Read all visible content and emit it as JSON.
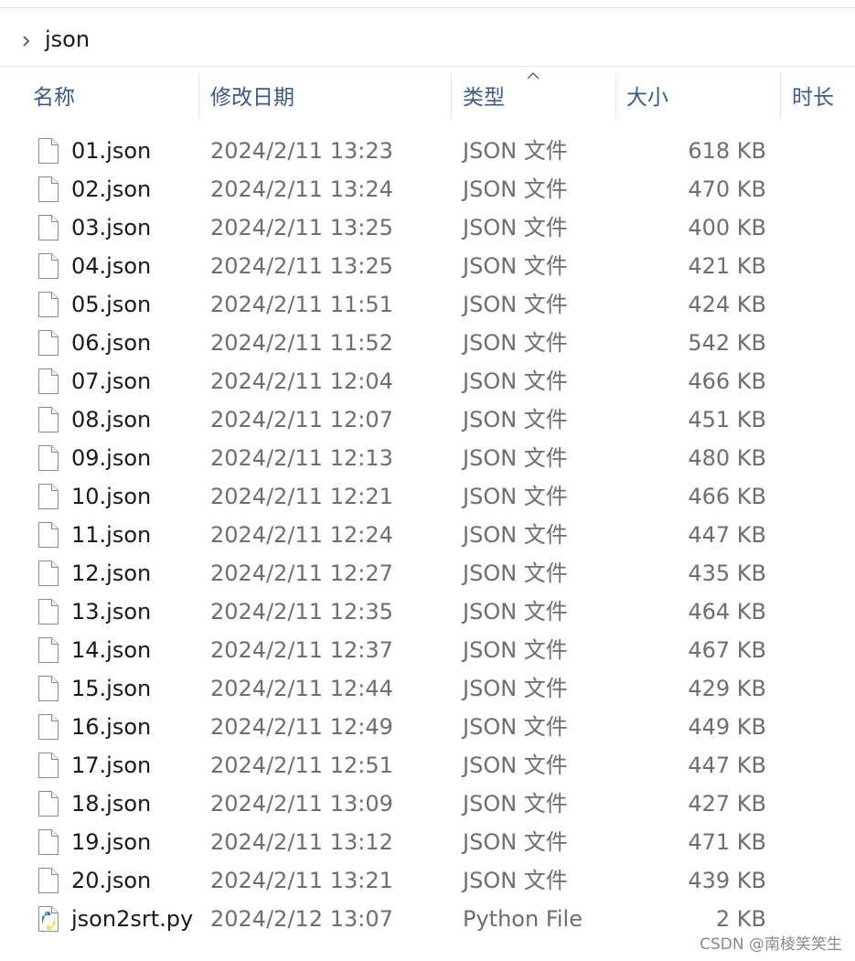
{
  "breadcrumb": {
    "label": "json"
  },
  "columns": {
    "name": "名称",
    "modified": "修改日期",
    "type": "类型",
    "size": "大小",
    "duration": "时长"
  },
  "sort": {
    "column": "type",
    "direction": "ascending"
  },
  "files": [
    {
      "name": "01.json",
      "modified": "2024/2/11 13:23",
      "type": "JSON 文件",
      "size": "618 KB",
      "icon": "json-file-icon"
    },
    {
      "name": "02.json",
      "modified": "2024/2/11 13:24",
      "type": "JSON 文件",
      "size": "470 KB",
      "icon": "json-file-icon"
    },
    {
      "name": "03.json",
      "modified": "2024/2/11 13:25",
      "type": "JSON 文件",
      "size": "400 KB",
      "icon": "json-file-icon"
    },
    {
      "name": "04.json",
      "modified": "2024/2/11 13:25",
      "type": "JSON 文件",
      "size": "421 KB",
      "icon": "json-file-icon"
    },
    {
      "name": "05.json",
      "modified": "2024/2/11 11:51",
      "type": "JSON 文件",
      "size": "424 KB",
      "icon": "json-file-icon"
    },
    {
      "name": "06.json",
      "modified": "2024/2/11 11:52",
      "type": "JSON 文件",
      "size": "542 KB",
      "icon": "json-file-icon"
    },
    {
      "name": "07.json",
      "modified": "2024/2/11 12:04",
      "type": "JSON 文件",
      "size": "466 KB",
      "icon": "json-file-icon"
    },
    {
      "name": "08.json",
      "modified": "2024/2/11 12:07",
      "type": "JSON 文件",
      "size": "451 KB",
      "icon": "json-file-icon"
    },
    {
      "name": "09.json",
      "modified": "2024/2/11 12:13",
      "type": "JSON 文件",
      "size": "480 KB",
      "icon": "json-file-icon"
    },
    {
      "name": "10.json",
      "modified": "2024/2/11 12:21",
      "type": "JSON 文件",
      "size": "466 KB",
      "icon": "json-file-icon"
    },
    {
      "name": "11.json",
      "modified": "2024/2/11 12:24",
      "type": "JSON 文件",
      "size": "447 KB",
      "icon": "json-file-icon"
    },
    {
      "name": "12.json",
      "modified": "2024/2/11 12:27",
      "type": "JSON 文件",
      "size": "435 KB",
      "icon": "json-file-icon"
    },
    {
      "name": "13.json",
      "modified": "2024/2/11 12:35",
      "type": "JSON 文件",
      "size": "464 KB",
      "icon": "json-file-icon"
    },
    {
      "name": "14.json",
      "modified": "2024/2/11 12:37",
      "type": "JSON 文件",
      "size": "467 KB",
      "icon": "json-file-icon"
    },
    {
      "name": "15.json",
      "modified": "2024/2/11 12:44",
      "type": "JSON 文件",
      "size": "429 KB",
      "icon": "json-file-icon"
    },
    {
      "name": "16.json",
      "modified": "2024/2/11 12:49",
      "type": "JSON 文件",
      "size": "449 KB",
      "icon": "json-file-icon"
    },
    {
      "name": "17.json",
      "modified": "2024/2/11 12:51",
      "type": "JSON 文件",
      "size": "447 KB",
      "icon": "json-file-icon"
    },
    {
      "name": "18.json",
      "modified": "2024/2/11 13:09",
      "type": "JSON 文件",
      "size": "427 KB",
      "icon": "json-file-icon"
    },
    {
      "name": "19.json",
      "modified": "2024/2/11 13:12",
      "type": "JSON 文件",
      "size": "471 KB",
      "icon": "json-file-icon"
    },
    {
      "name": "20.json",
      "modified": "2024/2/11 13:21",
      "type": "JSON 文件",
      "size": "439 KB",
      "icon": "json-file-icon"
    },
    {
      "name": "json2srt.py",
      "modified": "2024/2/12 13:07",
      "type": "Python File",
      "size": "2 KB",
      "icon": "python-file-icon"
    }
  ],
  "watermark": "CSDN @南棱笑笑生",
  "colors": {
    "header_text": "#3d5a80",
    "secondary_text": "#6e6e6e",
    "python_blue": "#3776ab",
    "python_yellow": "#ffd43b"
  }
}
